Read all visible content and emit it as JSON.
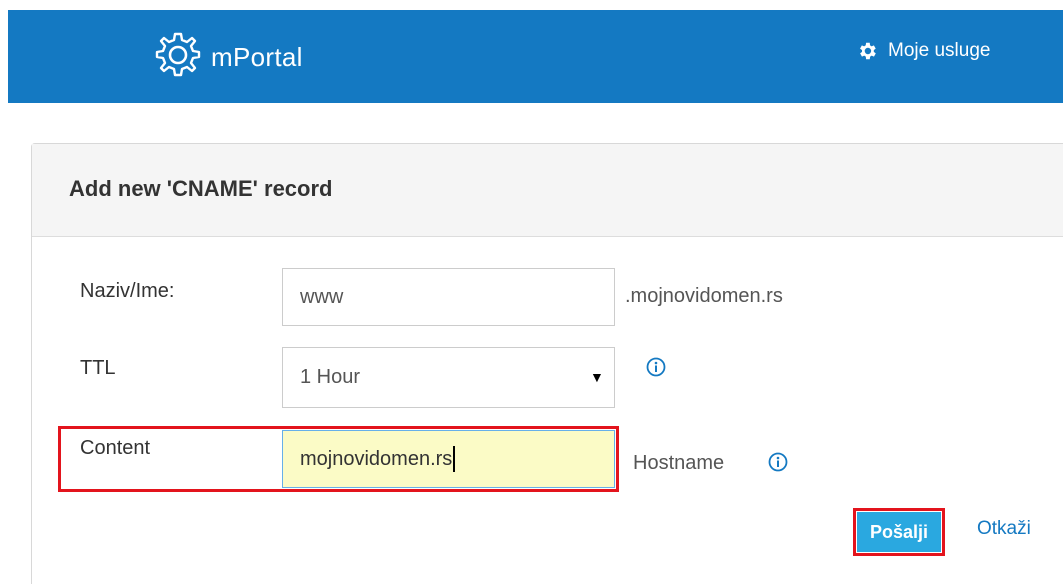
{
  "header": {
    "logo_text": "mPortal",
    "services_label": "Moje usluge",
    "icons": {
      "logo": "gear-circle-logo-icon",
      "services": "gear-icon"
    },
    "colors": {
      "bar": "#1479c2"
    }
  },
  "panel": {
    "title": "Add new 'CNAME' record"
  },
  "form": {
    "name": {
      "label": "Naziv/Ime:",
      "value": "www",
      "suffix": ".mojnovidomen.rs"
    },
    "ttl": {
      "label": "TTL",
      "selected": "1 Hour"
    },
    "content": {
      "label": "Content",
      "value": "mojnovidomen.rs",
      "type_label": "Hostname"
    }
  },
  "actions": {
    "send_label": "Pošalji",
    "cancel_label": "Otkaži"
  },
  "highlight_color": "#e3141d"
}
